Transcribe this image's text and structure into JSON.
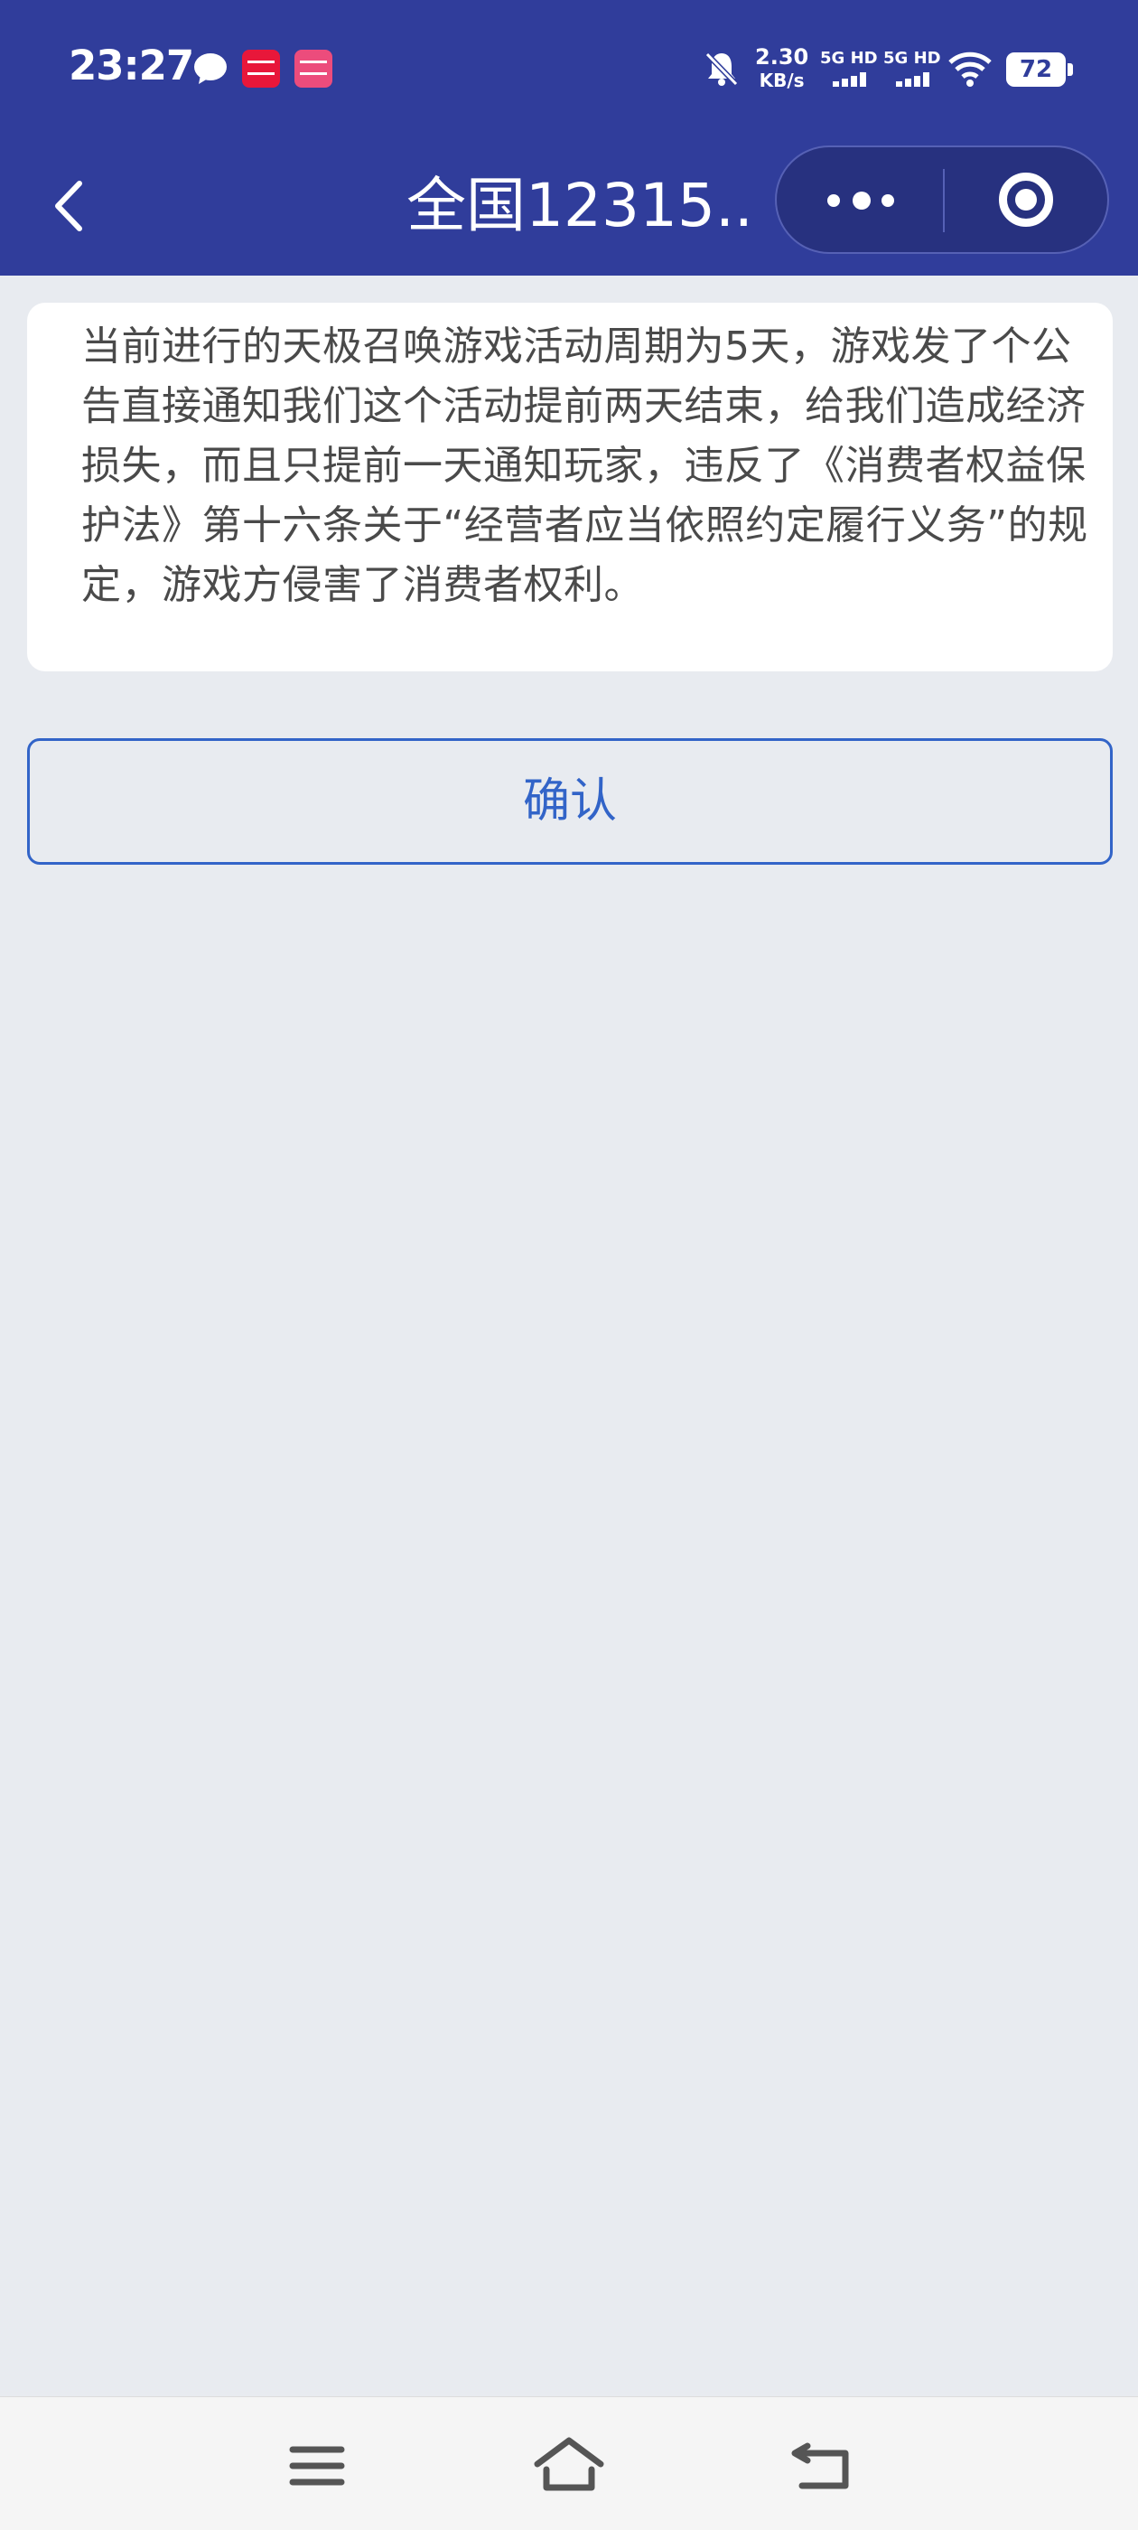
{
  "status_bar": {
    "time": "23:27",
    "net_speed_value": "2.30",
    "net_speed_unit": "KB/s",
    "signal1_label": "5G HD",
    "signal2_label": "5G HD",
    "battery": "72",
    "icons": [
      "chat-bubble-icon",
      "app-notification-icon",
      "app-notification-icon",
      "bell-muted-icon",
      "signal-icon",
      "signal-icon",
      "wifi-icon",
      "battery-icon"
    ]
  },
  "nav": {
    "title": "全国12315...",
    "back_icon": "chevron-left-icon",
    "more_icon": "more-dots-icon",
    "close_icon": "target-close-icon"
  },
  "content": {
    "text": "当前进行的天极召唤游戏活动周期为5天，游戏发了个公告直接通知我们这个活动提前两天结束，给我们造成经济损失，而且只提前一天通知玩家，违反了《消费者权益保护法》第十六条关于“经营者应当依照约定履行义务”的规定，游戏方侵害了消费者权利。"
  },
  "confirm_button": {
    "label": "确认"
  },
  "system_nav": {
    "icons": [
      "menu-icon",
      "home-icon",
      "back-icon"
    ]
  },
  "colors": {
    "header": "#303d9b",
    "accent": "#3264c8",
    "background": "#e8ebf0"
  }
}
